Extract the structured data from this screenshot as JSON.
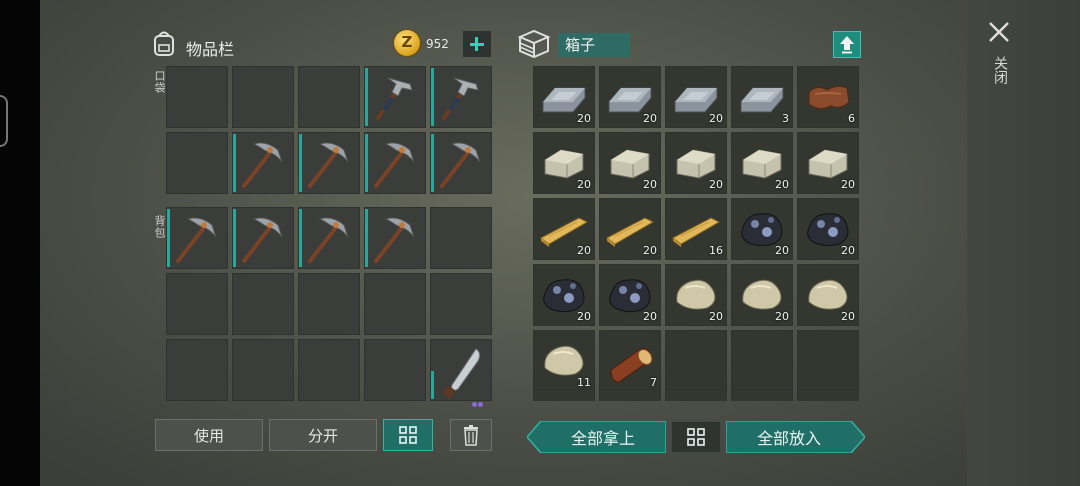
{
  "inventory": {
    "title": "物品栏",
    "coins": "952",
    "section_pocket": "口袋",
    "section_backpack": "背包",
    "pocket_slots": [
      {
        "item": "",
        "qty": ""
      },
      {
        "item": "",
        "qty": ""
      },
      {
        "item": "",
        "qty": ""
      },
      {
        "item": "hammer-icon",
        "qty": ""
      },
      {
        "item": "hammer-icon",
        "qty": ""
      },
      {
        "item": "",
        "qty": ""
      },
      {
        "item": "pickaxe-icon",
        "qty": ""
      },
      {
        "item": "pickaxe-icon",
        "qty": ""
      },
      {
        "item": "pickaxe-icon",
        "qty": ""
      },
      {
        "item": "pickaxe-icon",
        "qty": ""
      }
    ],
    "backpack_slots": [
      {
        "item": "pickaxe-icon",
        "qty": ""
      },
      {
        "item": "pickaxe-icon",
        "qty": ""
      },
      {
        "item": "pickaxe-icon",
        "qty": ""
      },
      {
        "item": "pickaxe-icon",
        "qty": ""
      },
      {
        "item": "",
        "qty": ""
      },
      {
        "item": "",
        "qty": ""
      },
      {
        "item": "",
        "qty": ""
      },
      {
        "item": "",
        "qty": ""
      },
      {
        "item": "",
        "qty": ""
      },
      {
        "item": "",
        "qty": ""
      },
      {
        "item": "",
        "qty": ""
      },
      {
        "item": "",
        "qty": ""
      },
      {
        "item": "",
        "qty": ""
      },
      {
        "item": "",
        "qty": ""
      },
      {
        "item": "machete-icon",
        "qty": ""
      }
    ],
    "use_label": "使用",
    "split_label": "分开"
  },
  "chest": {
    "title": "箱子",
    "slots": [
      {
        "item": "iron-ingot-icon",
        "qty": "20"
      },
      {
        "item": "iron-ingot-icon",
        "qty": "20"
      },
      {
        "item": "iron-ingot-icon",
        "qty": "20"
      },
      {
        "item": "iron-ingot-icon",
        "qty": "3"
      },
      {
        "item": "leather-icon",
        "qty": "6"
      },
      {
        "item": "stone-block-icon",
        "qty": "20"
      },
      {
        "item": "stone-block-icon",
        "qty": "20"
      },
      {
        "item": "stone-block-icon",
        "qty": "20"
      },
      {
        "item": "stone-block-icon",
        "qty": "20"
      },
      {
        "item": "stone-block-icon",
        "qty": "20"
      },
      {
        "item": "wood-plank-icon",
        "qty": "20"
      },
      {
        "item": "wood-plank-icon",
        "qty": "20"
      },
      {
        "item": "wood-plank-icon",
        "qty": "16"
      },
      {
        "item": "coal-ore-icon",
        "qty": "20"
      },
      {
        "item": "coal-ore-icon",
        "qty": "20"
      },
      {
        "item": "coal-ore-icon",
        "qty": "20"
      },
      {
        "item": "coal-ore-icon",
        "qty": "20"
      },
      {
        "item": "stone-icon",
        "qty": "20"
      },
      {
        "item": "stone-icon",
        "qty": "20"
      },
      {
        "item": "stone-icon",
        "qty": "20"
      },
      {
        "item": "stone-icon",
        "qty": "11"
      },
      {
        "item": "log-icon",
        "qty": "7"
      },
      {
        "item": "",
        "qty": ""
      },
      {
        "item": "",
        "qty": ""
      },
      {
        "item": "",
        "qty": ""
      }
    ],
    "take_all_label": "全部拿上",
    "put_all_label": "全部放入"
  },
  "close_label": "关闭",
  "colors": {
    "accent": "#2fb5a6",
    "panel": "#3a3d39"
  }
}
